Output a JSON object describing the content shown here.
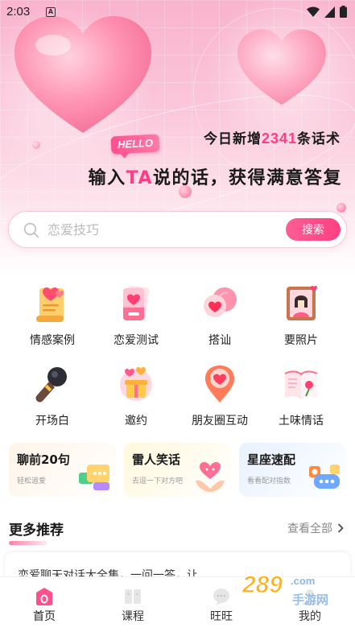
{
  "status_bar": {
    "time": "2:03",
    "notification_glyph": "A"
  },
  "hero": {
    "hello_tag": "HELLO",
    "new_count_prefix": "今日新增",
    "new_count_value": "2341",
    "new_count_suffix": "条话术",
    "headline_before": "输入",
    "headline_highlight": "TA",
    "headline_after": "说的话，获得满意答复"
  },
  "search": {
    "placeholder": "恋爱技巧",
    "button_label": "搜索"
  },
  "categories": [
    {
      "label": "情感案例",
      "icon": "scroll-heart-icon"
    },
    {
      "label": "恋爱测试",
      "icon": "love-test-card-icon"
    },
    {
      "label": "搭讪",
      "icon": "chat-heart-bubble-icon"
    },
    {
      "label": "要照片",
      "icon": "photo-frame-icon"
    },
    {
      "label": "开场白",
      "icon": "microphone-icon"
    },
    {
      "label": "邀约",
      "icon": "invitation-gift-icon"
    },
    {
      "label": "朋友圈互动",
      "icon": "heart-location-icon"
    },
    {
      "label": "土味情话",
      "icon": "open-book-icon"
    }
  ],
  "feature_cards": [
    {
      "title": "聊前20句",
      "subtitle": "轻松追爱"
    },
    {
      "title": "雷人笑话",
      "subtitle": "去逗一下对方吧"
    },
    {
      "title": "星座速配",
      "subtitle": "看看配对指数"
    }
  ],
  "more": {
    "title": "更多推荐",
    "view_all": "查看全部",
    "first_item_title": "恋爱聊天对话大全集，一问一答，让"
  },
  "tabbar": [
    {
      "label": "首页",
      "active": true
    },
    {
      "label": "课程",
      "active": false
    },
    {
      "label": "旺旺",
      "active": false
    },
    {
      "label": "我的",
      "active": false
    }
  ],
  "watermark": {
    "brand": "289",
    "suffix": ".com",
    "sub": "手游网"
  },
  "colors": {
    "accent": "#ff3d86",
    "hero_pink": "#f9b3cd",
    "text_dark": "#1a1a1a"
  }
}
